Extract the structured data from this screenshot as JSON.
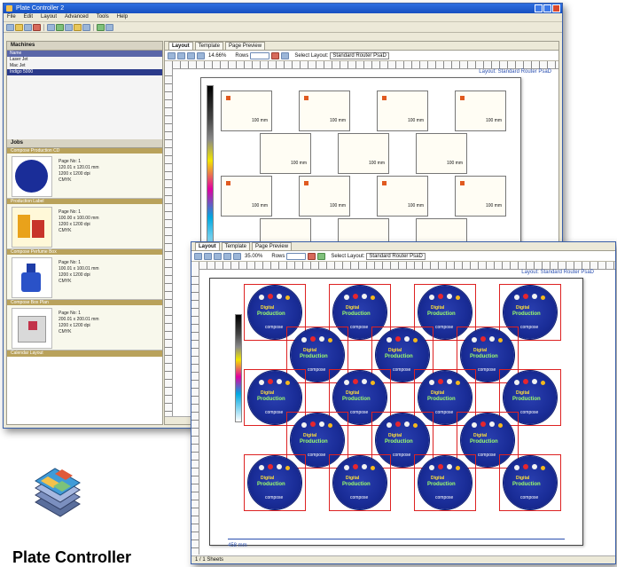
{
  "window1": {
    "title": "Plate Controller 2",
    "menu": [
      "File",
      "Edit",
      "Layout",
      "Advanced",
      "Tools",
      "Help"
    ],
    "tabs": [
      "Layout",
      "Template",
      "Page Preview"
    ],
    "zoom": "14.66%",
    "rows_label": "Rows",
    "select_layout_label": "Select Layout:",
    "select_layout_value": "Standard Router PsaD",
    "layout_label": "Layout: Standard Router PsaD",
    "measure_top": "100 mm",
    "measure_side": "100mm",
    "sidebar": {
      "machines_header": "Machines",
      "machines_col": "Name",
      "machines": [
        "Laser Jet",
        "Mac Jet",
        "Indigo 5000"
      ],
      "jobs_header": "Jobs",
      "jobs": [
        {
          "title": "Compose Production CD",
          "l1": "Page No: 1",
          "l2": "120.01 x 120.01 mm",
          "l3": "1200 x 1200 dpi",
          "l4": "CMYK"
        },
        {
          "title": "Production Label",
          "l1": "Page No: 1",
          "l2": "100.00 x 100.00 mm",
          "l3": "1200 x 1200 dpi",
          "l4": "CMYK"
        },
        {
          "title": "Compose Perfume Box",
          "l1": "Page No: 1",
          "l2": "100.01 x 100.01 mm",
          "l3": "1200 x 1200 dpi",
          "l4": "CMYK"
        },
        {
          "title": "Compose Box Plan",
          "l1": "Page No: 1",
          "l2": "200.01 x 200.01 mm",
          "l3": "1200 x 1200 dpi",
          "l4": "CMYK"
        }
      ],
      "jobs_footer": "Calendar Layout"
    },
    "cells": [
      {
        "label": "100 mm",
        "side": "100mm"
      },
      {
        "label": "100 mm",
        "side": "100mm"
      },
      {
        "label": "100 mm",
        "side": "100mm"
      },
      {
        "label": "100 mm",
        "side": "100mm"
      }
    ]
  },
  "window2": {
    "tabs": [
      "Layout",
      "Template",
      "Page Preview"
    ],
    "zoom": "35.00%",
    "rows_label": "Rows",
    "select_layout_label": "Select Layout:",
    "select_layout_value": "Standard Router PsaD",
    "layout_label": "Layout: Standard Router PsaD",
    "disc_brand": "compose",
    "disc_product": "Production",
    "disc_sub": "Digital",
    "bottom_measure": "458 mm",
    "status": "1 / 1 Sheets"
  },
  "product": {
    "name": "Plate Controller",
    "icon": "plate-controller-icon"
  },
  "colors": {
    "titlebar": "#164fc0",
    "disc": "#1a2d98",
    "cell_border": "#d22222",
    "layout_label": "#2a4fb0"
  }
}
